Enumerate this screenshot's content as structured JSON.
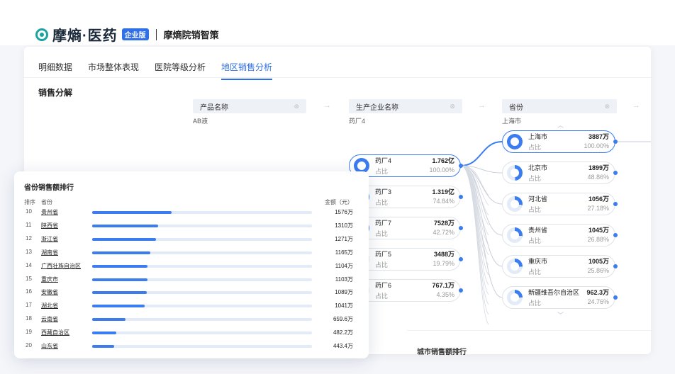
{
  "header": {
    "brand": "摩熵·医药",
    "badge": "企业版",
    "product": "摩熵院销智策"
  },
  "tabs": [
    {
      "label": "明细数据",
      "active": false
    },
    {
      "label": "市场整体表现",
      "active": false
    },
    {
      "label": "医院等级分析",
      "active": false
    },
    {
      "label": "地区销售分析",
      "active": true
    }
  ],
  "section_title": "销售分解",
  "filters": {
    "product": {
      "label": "产品名称",
      "value": "AB液"
    },
    "company": {
      "label": "生产企业名称",
      "value": "药厂4"
    },
    "province": {
      "label": "省份",
      "value": "上海市"
    }
  },
  "share_label": "占比",
  "company_nodes": [
    {
      "name": "药厂4",
      "value": "1.762亿",
      "pct": "100.00%",
      "frac": 1.0,
      "selected": true
    },
    {
      "name": "药厂3",
      "value": "1.319亿",
      "pct": "74.84%",
      "frac": 0.7484,
      "selected": false
    },
    {
      "name": "药厂7",
      "value": "7528万",
      "pct": "42.72%",
      "frac": 0.4272,
      "selected": false
    },
    {
      "name": "药厂5",
      "value": "3488万",
      "pct": "19.79%",
      "frac": 0.1979,
      "selected": false
    },
    {
      "name": "药厂6",
      "value": "767.1万",
      "pct": "4.35%",
      "frac": 0.0435,
      "selected": false
    }
  ],
  "province_nodes": [
    {
      "name": "上海市",
      "value": "3887万",
      "pct": "100.00%",
      "frac": 1.0,
      "selected": true
    },
    {
      "name": "北京市",
      "value": "1899万",
      "pct": "48.86%",
      "frac": 0.4886,
      "selected": false
    },
    {
      "name": "河北省",
      "value": "1056万",
      "pct": "27.18%",
      "frac": 0.2718,
      "selected": false
    },
    {
      "name": "贵州省",
      "value": "1045万",
      "pct": "26.88%",
      "frac": 0.2688,
      "selected": false
    },
    {
      "name": "重庆市",
      "value": "1005万",
      "pct": "25.86%",
      "frac": 0.2586,
      "selected": false
    },
    {
      "name": "新疆维吾尔自治区",
      "value": "962.3万",
      "pct": "24.76%",
      "frac": 0.2476,
      "selected": false
    }
  ],
  "city_section_title": "城市销售额排行",
  "ranking": {
    "title": "省份销售额排行",
    "col_rank": "排序",
    "col_province": "省份",
    "col_amount": "金额（元）",
    "rows": [
      {
        "rank": "10",
        "province": "贵州省",
        "amount": "1576万",
        "value": 1576
      },
      {
        "rank": "11",
        "province": "陕西省",
        "amount": "1310万",
        "value": 1310
      },
      {
        "rank": "12",
        "province": "浙江省",
        "amount": "1271万",
        "value": 1271
      },
      {
        "rank": "13",
        "province": "湖南省",
        "amount": "1165万",
        "value": 1165
      },
      {
        "rank": "14",
        "province": "广西壮族自治区",
        "amount": "1104万",
        "value": 1104
      },
      {
        "rank": "15",
        "province": "重庆市",
        "amount": "1103万",
        "value": 1103
      },
      {
        "rank": "16",
        "province": "安徽省",
        "amount": "1089万",
        "value": 1089
      },
      {
        "rank": "17",
        "province": "湖北省",
        "amount": "1041万",
        "value": 1041
      },
      {
        "rank": "18",
        "province": "云南省",
        "amount": "659.6万",
        "value": 659.6
      },
      {
        "rank": "19",
        "province": "西藏自治区",
        "amount": "482.2万",
        "value": 482.2
      },
      {
        "rank": "20",
        "province": "山东省",
        "amount": "443.4万",
        "value": 443.4
      }
    ]
  },
  "colors": {
    "accent": "#3b7cf0",
    "brand": "#1aa3a0",
    "track": "#e3ebf9"
  }
}
